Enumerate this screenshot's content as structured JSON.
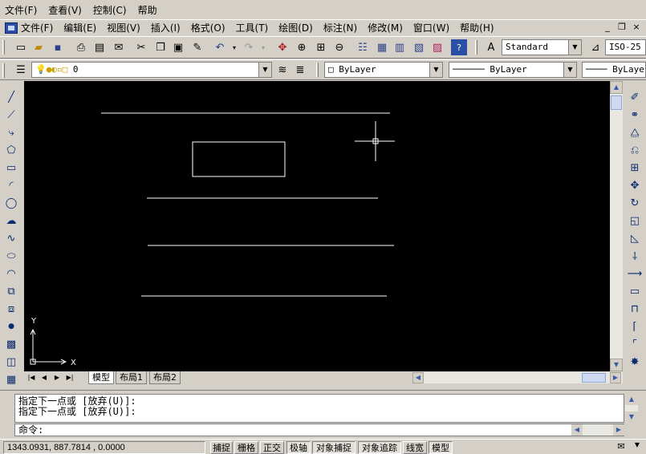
{
  "outer_menu": [
    "文件(F)",
    "查看(V)",
    "控制(C)",
    "帮助"
  ],
  "inner_menu": [
    "文件(F)",
    "编辑(E)",
    "视图(V)",
    "插入(I)",
    "格式(O)",
    "工具(T)",
    "绘图(D)",
    "标注(N)",
    "修改(M)",
    "窗口(W)",
    "帮助(H)"
  ],
  "window_controls": [
    "_",
    "❐",
    "×"
  ],
  "toolbar": {
    "text_style": "Standard",
    "dim_style": "ISO-25",
    "layer_name": "0",
    "color": "ByLayer",
    "linetype": "ByLayer",
    "lineweight": "ByLayer"
  },
  "ucs": {
    "x_label": "X",
    "y_label": "Y"
  },
  "tabs": [
    "模型",
    "布局1",
    "布局2"
  ],
  "active_tab": "模型",
  "command": {
    "history": [
      "指定下一点或 [放弃(U)]:",
      "指定下一点或 [放弃(U)]:"
    ],
    "prompt": "命令:"
  },
  "status": {
    "coords": "1343.0931, 887.7814 , 0.0000",
    "buttons": [
      "捕捉",
      "栅格",
      "正交",
      "极轴",
      "对象捕捉",
      "对象追踪",
      "线宽",
      "模型"
    ]
  },
  "colors": {
    "drawing_bg": "#000000",
    "drawing_lines": "#ffffff",
    "ui_bg": "#d4d0c8"
  }
}
